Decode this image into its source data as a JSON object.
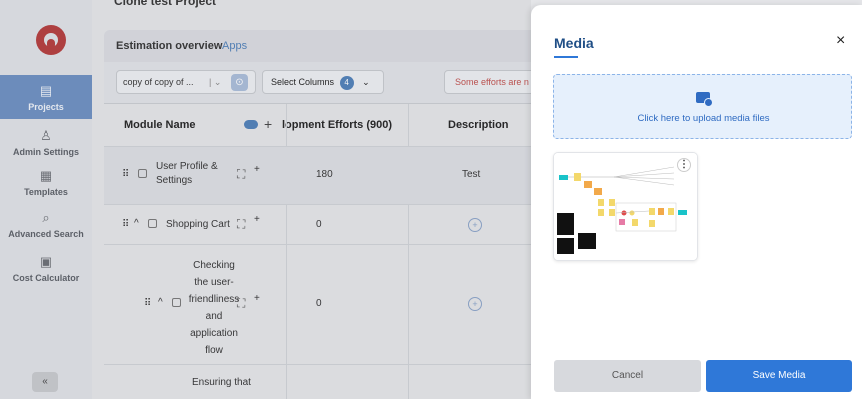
{
  "sidebar": {
    "items": [
      {
        "label": "Projects",
        "icon": "clipboard-icon"
      },
      {
        "label": "Admin Settings",
        "icon": "user-gear-icon"
      },
      {
        "label": "Templates",
        "icon": "template-icon"
      },
      {
        "label": "Advanced Search",
        "icon": "search-doc-icon"
      },
      {
        "label": "Cost Calculator",
        "icon": "calculator-icon"
      }
    ],
    "collapse_glyph": "«"
  },
  "main": {
    "project_title": "Clone test Project",
    "tabs": [
      {
        "label": "Estimation overview"
      },
      {
        "label": "Apps"
      }
    ],
    "toolbar": {
      "view_value": "copy of copy of ...",
      "select_columns_label": "Select Columns",
      "select_columns_count": "4",
      "warning_text": "Some efforts are n"
    },
    "table": {
      "headers": {
        "module": "Module Name",
        "efforts": "lopment Efforts (900)",
        "description": "Description"
      },
      "rows": [
        {
          "name_line1": "User Profile &",
          "name_line2": "Settings",
          "efforts": "180",
          "description": "Test"
        },
        {
          "name": "Shopping Cart",
          "efforts": "0"
        },
        {
          "name_lines": [
            "Checking",
            "the user-",
            "friendliness",
            "and",
            "application",
            "flow"
          ],
          "efforts": "0"
        },
        {
          "name_partial": "Ensuring that"
        }
      ]
    }
  },
  "drawer": {
    "title": "Media",
    "close_glyph": "×",
    "upload_text": "Click here to upload media files",
    "cancel_label": "Cancel",
    "save_label": "Save Media",
    "accent_color": "#2f78d8"
  }
}
